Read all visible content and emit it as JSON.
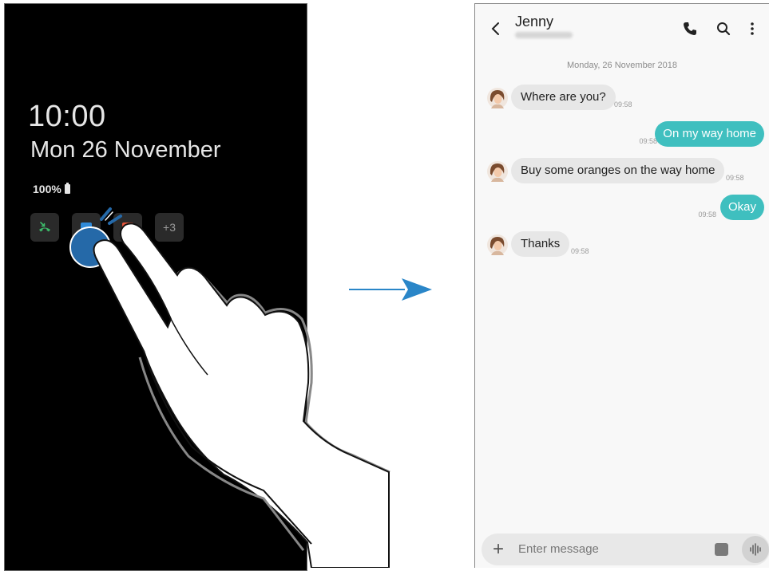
{
  "aod": {
    "time": "10:00",
    "date": "Mon 26 November",
    "battery": "100%",
    "notifications": [
      {
        "icon": "missed-call-icon",
        "color": "#3dba6a"
      },
      {
        "icon": "message-icon",
        "color": "#2f8ad8"
      },
      {
        "icon": "email-icon",
        "color": "#e5553a"
      }
    ],
    "more_count": "+3"
  },
  "conversation": {
    "contact_name": "Jenny",
    "date_separator": "Monday, 26 November 2018",
    "messages": [
      {
        "direction": "in",
        "text": "Where are you?",
        "time": "09:58"
      },
      {
        "direction": "out",
        "text": "On my way home",
        "time": "09:58"
      },
      {
        "direction": "in",
        "text": "Buy some oranges on the way home",
        "time": "09:58"
      },
      {
        "direction": "out",
        "text": "Okay",
        "time": "09:58"
      },
      {
        "direction": "in",
        "text": "Thanks",
        "time": "09:58"
      }
    ],
    "compose_placeholder": "Enter message"
  },
  "colors": {
    "accent": "#3fbfbf",
    "arrow": "#2a86c8",
    "tap": "#2569a8"
  }
}
